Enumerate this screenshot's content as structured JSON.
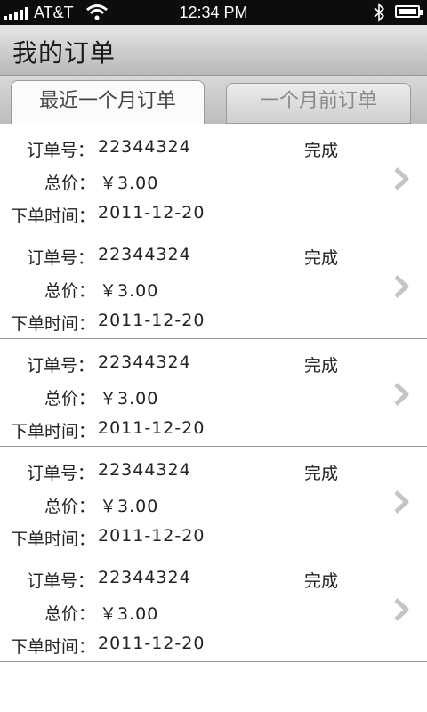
{
  "status_bar": {
    "carrier": "AT&T",
    "time": "12:34 PM"
  },
  "title": "我的订单",
  "tabs": [
    {
      "label": "最近一个月订单",
      "active": true
    },
    {
      "label": "一个月前订单",
      "active": false
    }
  ],
  "labels": {
    "order_no": "订单号：",
    "total": "总价：",
    "order_time": "下单时间："
  },
  "orders": [
    {
      "order_no": "22344324",
      "status": "完成",
      "price": "￥3.00",
      "time": "2011-12-20"
    },
    {
      "order_no": "22344324",
      "status": "完成",
      "price": "￥3.00",
      "time": "2011-12-20"
    },
    {
      "order_no": "22344324",
      "status": "完成",
      "price": "￥3.00",
      "time": "2011-12-20"
    },
    {
      "order_no": "22344324",
      "status": "完成",
      "price": "￥3.00",
      "time": "2011-12-20"
    },
    {
      "order_no": "22344324",
      "status": "完成",
      "price": "￥3.00",
      "time": "2011-12-20"
    }
  ],
  "colors": {
    "price": "#e60000",
    "status_bar_bg": "#0d0d0d"
  }
}
